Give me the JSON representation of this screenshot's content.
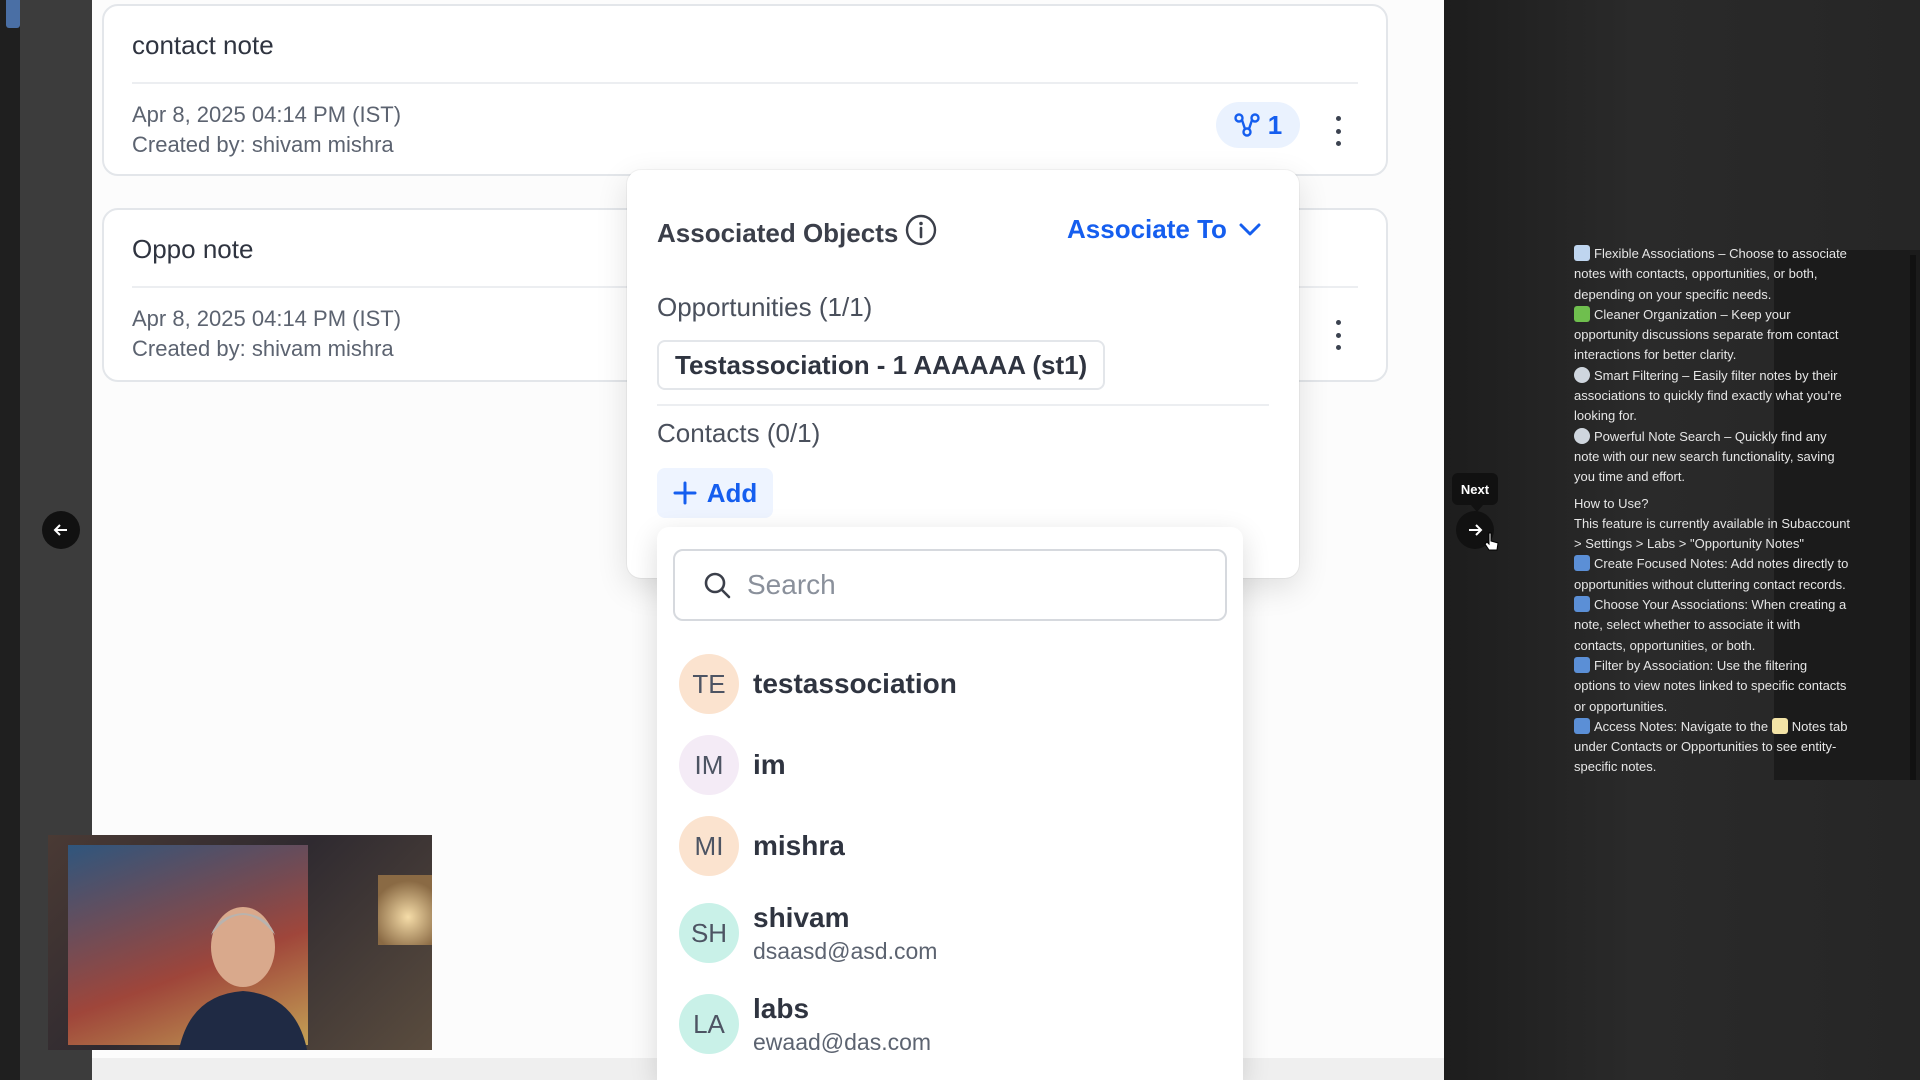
{
  "notes": [
    {
      "title": "contact note",
      "date": "Apr 8, 2025 04:14 PM (IST)",
      "creator": "Created by: shivam mishra",
      "association_count": "1"
    },
    {
      "title": "Oppo note",
      "date": "Apr 8, 2025 04:14 PM (IST)",
      "creator": "Created by: shivam mishra"
    }
  ],
  "popover": {
    "title": "Associated Objects",
    "associate_to": "Associate To",
    "opportunities_header": "Opportunities (1/1)",
    "opportunity_chip": "Testassociation - 1 AAAAAA (st1)",
    "contacts_header": "Contacts (0/1)",
    "add_label": "Add"
  },
  "dropdown": {
    "search_placeholder": "Search",
    "contacts": [
      {
        "initials": "TE",
        "name": "testassociation",
        "email": "",
        "color": "#fbe3cf"
      },
      {
        "initials": "IM",
        "name": "im",
        "email": "",
        "color": "#f4ebf6"
      },
      {
        "initials": "MI",
        "name": "mishra",
        "email": "",
        "color": "#fbe3cf"
      },
      {
        "initials": "SH",
        "name": "shivam",
        "email": "dsaasd@asd.com",
        "color": "#c9f1e8"
      },
      {
        "initials": "LA",
        "name": "labs",
        "email": "ewaad@das.com",
        "color": "#c9f1e8"
      }
    ]
  },
  "nav": {
    "next_tooltip": "Next"
  },
  "tips": {
    "l1": "Flexible Associations – Choose to associate",
    "l2": "notes with contacts, opportunities, or both,",
    "l3": "depending on your specific needs.",
    "l4": "Cleaner Organization – Keep your",
    "l5": "opportunity discussions separate from contact",
    "l6": "interactions for better clarity.",
    "l7": "Smart Filtering – Easily filter notes by their",
    "l8": "associations to quickly find exactly what you're",
    "l9": "looking for.",
    "l10": "Powerful Note Search – Quickly find any",
    "l11": "note with our new search functionality, saving",
    "l12": "you time and effort.",
    "l13": "How to Use?",
    "l14": "This feature is currently available in Subaccount",
    "l15": "> Settings > Labs > \"Opportunity Notes\"",
    "l16": "Create Focused Notes: Add notes directly to",
    "l17": "opportunities without cluttering contact records.",
    "l18": "Choose Your Associations: When creating a",
    "l19": "note, select whether to associate it with",
    "l20": "contacts, opportunities, or both.",
    "l21": "Filter by Association: Use the filtering",
    "l22": "options to view notes linked to specific contacts",
    "l23": "or opportunities.",
    "l24a": "Access Notes: Navigate to the",
    "l24b": "Notes tab",
    "l25": "under Contacts or Opportunities to see entity-",
    "l26": "specific notes."
  },
  "colors": {
    "accent": "#155eef",
    "badge_bg": "#eaf2fe"
  }
}
